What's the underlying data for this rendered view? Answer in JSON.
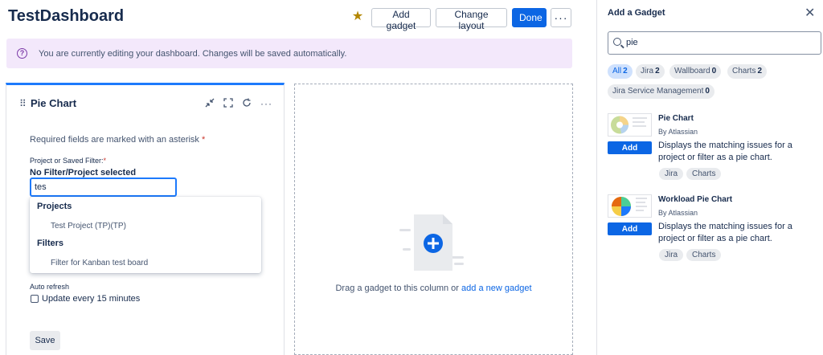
{
  "header": {
    "title": "TestDashboard",
    "star_icon": "star-icon",
    "add_gadget": "Add gadget",
    "change_layout": "Change layout",
    "done": "Done",
    "more": "···"
  },
  "banner": {
    "icon": "info-icon",
    "text": "You are currently editing your dashboard. Changes will be saved automatically."
  },
  "gadget": {
    "title": "Pie Chart",
    "required_text": "Required fields are marked with an asterisk",
    "asterisk": "*",
    "filter_label": "Project or Saved Filter:",
    "filter_value": "No Filter/Project selected",
    "filter_input": "tes",
    "dropdown": {
      "projects_heading": "Projects",
      "project_item": "Test Project (TP)(TP)",
      "filters_heading": "Filters",
      "filter_item": "Filter for Kanban test board"
    },
    "auto_refresh_label": "Auto refresh",
    "auto_refresh_option": "Update every 15 minutes",
    "save": "Save"
  },
  "empty_column": {
    "text": "Drag a gadget to this column or",
    "link": "add a new gadget"
  },
  "panel": {
    "title": "Add a Gadget",
    "search_value": "pie",
    "chips": [
      {
        "label": "All",
        "count": "2",
        "active": true
      },
      {
        "label": "Jira",
        "count": "2"
      },
      {
        "label": "Wallboard",
        "count": "0"
      },
      {
        "label": "Charts",
        "count": "2"
      },
      {
        "label": "Jira Service Management",
        "count": "0"
      }
    ],
    "gadgets": [
      {
        "name": "Pie Chart",
        "by": "By Atlassian",
        "add": "Add",
        "desc": "Displays the matching issues for a project or filter as a pie chart.",
        "tags": [
          "Jira",
          "Charts"
        ]
      },
      {
        "name": "Workload Pie Chart",
        "by": "By Atlassian",
        "add": "Add",
        "desc": "Displays the matching issues for a project or filter as a pie chart.",
        "tags": [
          "Jira",
          "Charts"
        ]
      }
    ]
  },
  "colors": {
    "primary": "#0c66e4",
    "banner_bg": "#f3e8fb",
    "star": "#b38600"
  }
}
